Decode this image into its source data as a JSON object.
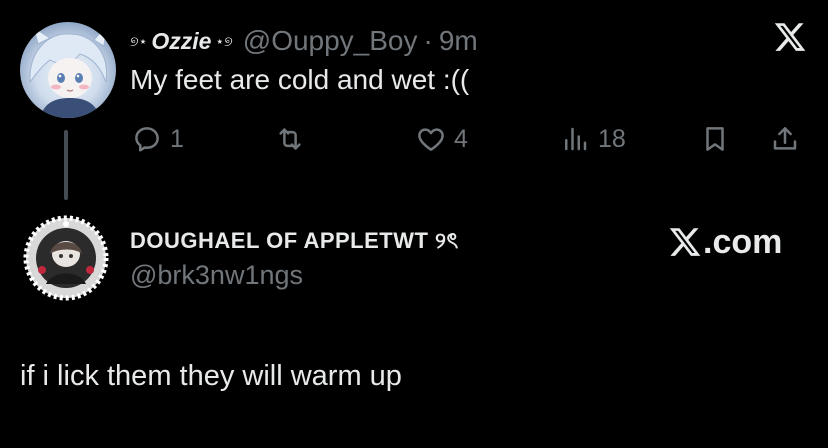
{
  "parent_tweet": {
    "display_name_deco_left": "୭⋆",
    "display_name": "Ozzie",
    "display_name_deco_right": "⋆୭",
    "handle": "@Ouppy_Boy",
    "separator": "·",
    "time": "9m",
    "text": "My feet are cold and wet :((",
    "actions": {
      "reply_count": "1",
      "retweet_count": "",
      "like_count": "4",
      "views_count": "18"
    },
    "icons": {
      "platform": "x-logo-icon",
      "reply": "speech-bubble-icon",
      "retweet": "retweet-icon",
      "like": "heart-icon",
      "views": "bar-chart-icon",
      "bookmark": "bookmark-icon",
      "share": "share-icon"
    }
  },
  "quote_card": {
    "display_name": "DOUGHAEL OF APPLETWT ୨ৎ",
    "handle": "@brk3nw1ngs",
    "brand": ".com",
    "reply_text": "if i lick them they will warm up"
  },
  "colors": {
    "background": "#000000",
    "primary_text": "#e7e9ea",
    "secondary_text": "#71767b",
    "thread_line": "#444b52"
  }
}
